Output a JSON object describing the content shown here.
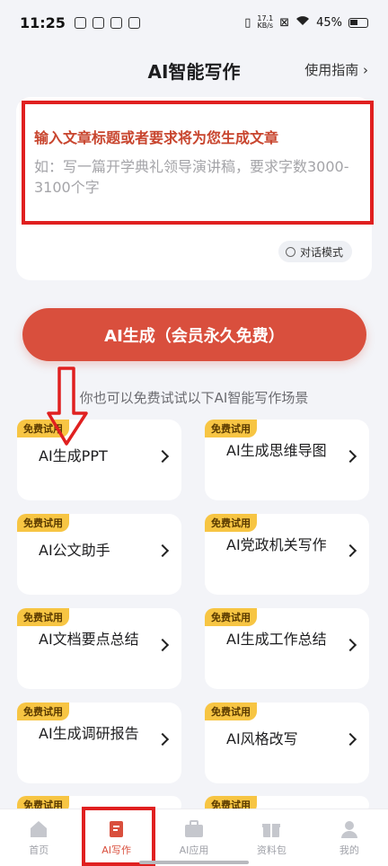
{
  "status_bar": {
    "time": "11:25",
    "net_speed_value": "17.1",
    "net_speed_unit": "KB/s",
    "battery": "45%"
  },
  "header": {
    "title": "AI智能写作",
    "guide_link": "使用指南 ›"
  },
  "input": {
    "prompt": "输入文章标题或者要求将为您生成文章",
    "placeholder": "如：写一篇开学典礼领导演讲稿，要求字数3000-3100个字",
    "dialog_mode": "对话模式"
  },
  "generate_button": "AI生成（会员永久免费）",
  "hint_text": "你也可以免费试试以下AI智能写作场景",
  "badge_text": "免费试用",
  "scenarios": [
    {
      "label": "AI生成PPT"
    },
    {
      "label": "AI生成思维导图"
    },
    {
      "label": "AI公文助手"
    },
    {
      "label": "AI党政机关写作"
    },
    {
      "label": "AI文档要点总结"
    },
    {
      "label": "AI生成工作总结"
    },
    {
      "label": "AI生成调研报告"
    },
    {
      "label": "AI风格改写"
    }
  ],
  "tabs": [
    {
      "label": "首页",
      "icon": "home-icon"
    },
    {
      "label": "AI写作",
      "icon": "write-icon",
      "active": true
    },
    {
      "label": "AI应用",
      "icon": "toolbox-icon"
    },
    {
      "label": "资料包",
      "icon": "gift-icon"
    },
    {
      "label": "我的",
      "icon": "user-icon"
    }
  ],
  "colors": {
    "accent": "#d94f3d",
    "badge": "#f7c543",
    "annotation": "#e02020"
  }
}
